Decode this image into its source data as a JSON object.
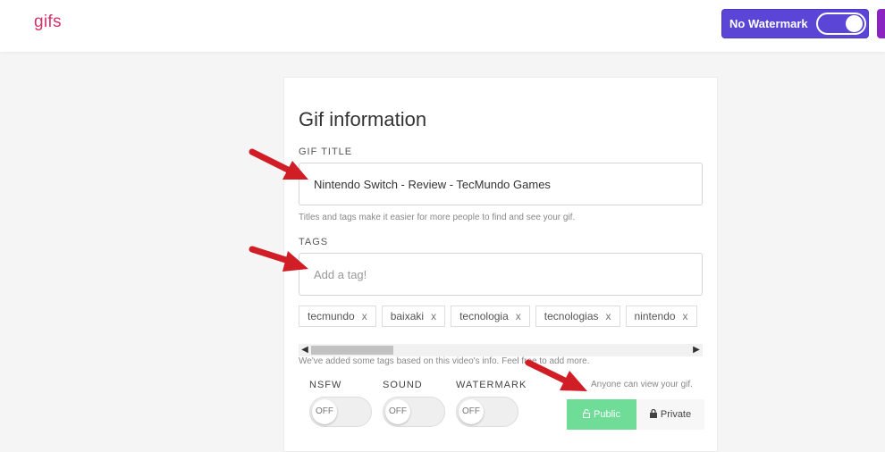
{
  "header": {
    "brand": "gifs",
    "watermark_toggle": {
      "label": "No Watermark",
      "enabled": true
    }
  },
  "form": {
    "title": "Gif information",
    "gif_title": {
      "label": "GIF TITLE",
      "value": "Nintendo Switch - Review - TecMundo Games",
      "helper": "Titles and tags make it easier for more people to find and see your gif."
    },
    "tags": {
      "label": "TAGS",
      "placeholder": "Add a tag!",
      "items": [
        "tecmundo",
        "baixaki",
        "tecnologia",
        "tecnologias",
        "nintendo"
      ],
      "remove_glyph": "x",
      "helper": "We've added some tags based on this video's info. Feel free to add more."
    },
    "toggles": [
      {
        "label": "NSFW",
        "state": "OFF"
      },
      {
        "label": "SOUND",
        "state": "OFF"
      },
      {
        "label": "WATERMARK",
        "state": "OFF"
      }
    ],
    "visibility": {
      "info": "Anyone can view your gif.",
      "public_label": "Public",
      "private_label": "Private",
      "selected": "Public"
    }
  },
  "colors": {
    "brand": "#d23366",
    "watermark_button": "#5a45d6",
    "public_selected": "#6fdc97",
    "annotation_arrow": "#d01d26"
  }
}
